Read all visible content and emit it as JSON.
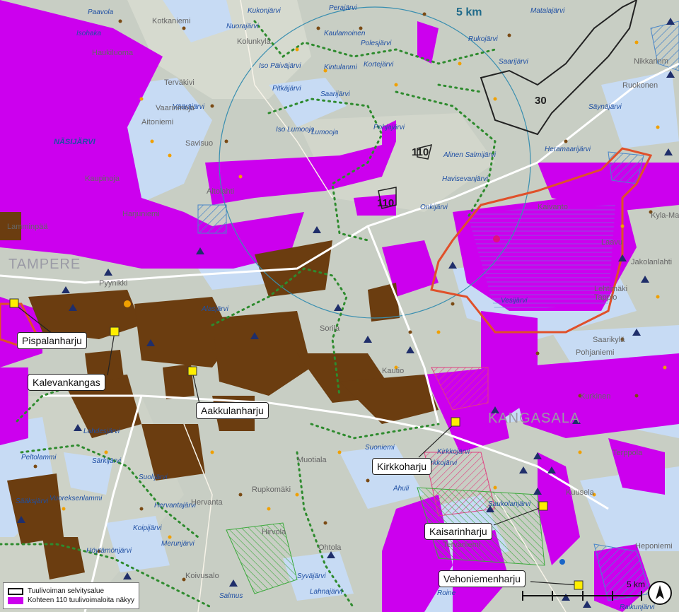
{
  "map": {
    "distance_ring_label": "5 km",
    "road_numbers": [
      "30",
      "110",
      "110"
    ],
    "city_labels": [
      "TAMPERE",
      "KANGASALA"
    ],
    "lake_labels": [
      "Paavola",
      "Kukonjärvi",
      "Perajärvi",
      "Matalajärvi",
      "Isohaka",
      "Nuorajärvi",
      "Kolunkylä",
      "Kaulamoinen",
      "Polesjärvi",
      "Rukojärvi",
      "Saarijärvi",
      "Iso Päiväjärvi",
      "Kintulanmi",
      "Kortejärvi",
      "Pitkäjärvi",
      "Saarijärvi",
      "Vääräjärvi",
      "Säynäjärvi",
      "Iso Lumooja",
      "Lumooja",
      "Pohjajärvi",
      "NÄSIJÄRVI",
      "Alinen Salmijärvi",
      "Heramaarijärvi",
      "Havisevanjärvi",
      "Onkijärvi",
      "Vesijärvi",
      "Alasjärvi",
      "Lahdesjärvi",
      "Särkijärvi",
      "Suolijärvi",
      "Peltolammi",
      "Sääksjärvi",
      "Vuoreksenlammi",
      "Hervantajärvi",
      "Koipijärvi",
      "Merunjärvi",
      "Höytämönjärvi",
      "Suoniemi",
      "Kirkkojärvi",
      "Ahuli",
      "Saukolanjärvi",
      "Syväjärvi",
      "Lahnajärvi",
      "Salmus",
      "Roine",
      "Raikunjärvi",
      "Kirkkojärvi"
    ],
    "place_labels": [
      "Kotkaniemi",
      "Haukiluoma",
      "Terväkivi",
      "Aitoniemi",
      "Vaarinmaja",
      "Savisuo",
      "Altolahti",
      "Harjuniemi",
      "Kaupinoja",
      "Ruokonen",
      "Nikkarinm",
      "Kyla-Mattila",
      "Kaivanto",
      "Lamminpää",
      "Pyynikki",
      "Hervanta",
      "Muotiala",
      "Rupkomäki",
      "Hirvola",
      "Ohtola",
      "Koivusalo",
      "Tervaniemi",
      "Heponiemi",
      "Saarikylä",
      "Kuusela",
      "Terppola",
      "Pohjaniemi",
      "Jakolanlahti",
      "Laavu",
      "Lehtimäki",
      "Kurkinen",
      "Tappio",
      "Kautio",
      "Sorila"
    ]
  },
  "sites": [
    {
      "label": "Pispalanharju"
    },
    {
      "label": "Kalevankangas"
    },
    {
      "label": "Aakkulanharju"
    },
    {
      "label": "Kirkkoharju"
    },
    {
      "label": "Kaisarinharju"
    },
    {
      "label": "Vehoniemenharju"
    }
  ],
  "legend": {
    "items": [
      {
        "label": "Tuulivoiman selvitysalue",
        "swatch": "outline"
      },
      {
        "label": "Kohteen 110 tuulivoimaloita näkyy",
        "swatch": "magenta"
      }
    ]
  },
  "scalebar": {
    "label": "5 km"
  },
  "colors": {
    "visibility": "#cc00ee",
    "study_area": "#e0502a",
    "water": "#c7dbf4",
    "forest": "#6b3d10",
    "trail": "#2e8b2e",
    "site_marker": "#ffee00"
  }
}
